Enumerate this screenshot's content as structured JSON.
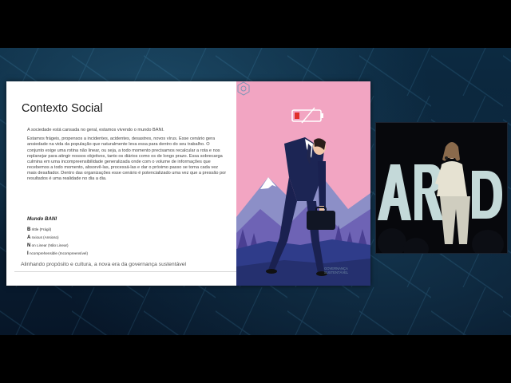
{
  "slide": {
    "title": "Contexto Social",
    "paragraph_1": "A sociedade está cansada no geral, estamos vivendo o mundo BANI.",
    "paragraph_2": "Estamos frágeis, propensos a incidentes, acidentes, desastres, novos vírus. Esse cenário gera ansiedade na vida da população que naturalmente leva essa para dentro do seu trabalho. O conjunto exige uma rotina não linear, ou seja, a todo momento precisamos recalcular a rota e nos replanejar para atingir nossos objetivos, tanto os diários como os de longo prazo. Essa sobrecarga culmina em uma incompreensibilidade generalizada onde com o volume de informações que recebemos a todo momento, absorvê-las, processá-las e dar o próximo passo se torna cada vez mais desafiador. Dentro das organizações esse cenário é potencializado uma vez que a pressão por resultados é uma realidade no dia a dia.",
    "bani_title": "Mundo BANI",
    "bani_items": [
      {
        "letter": "B",
        "text": "rittle (Frágil)"
      },
      {
        "letter": "A",
        "text": "nxious (Ansioso)"
      },
      {
        "letter": "N",
        "text": "on Linear (Não Linear)"
      },
      {
        "letter": "I",
        "text": "ncomprehensible (Incompreensível)"
      }
    ],
    "footer": "Alinhando propósito e cultura, a nova era da governança sustentável",
    "logo_text_1": "GOVERNANÇA",
    "logo_text_2": "SUSTENTÁVEL"
  },
  "colors": {
    "slide_bg": "#ffffff",
    "illustration_bg": "#f2a5c2",
    "battery_low": "#e0302b",
    "stage_bg": "#0c2a41"
  },
  "icons": [
    "battery-low-icon",
    "governance-logo-icon"
  ],
  "video": {
    "subject": "speaker"
  }
}
